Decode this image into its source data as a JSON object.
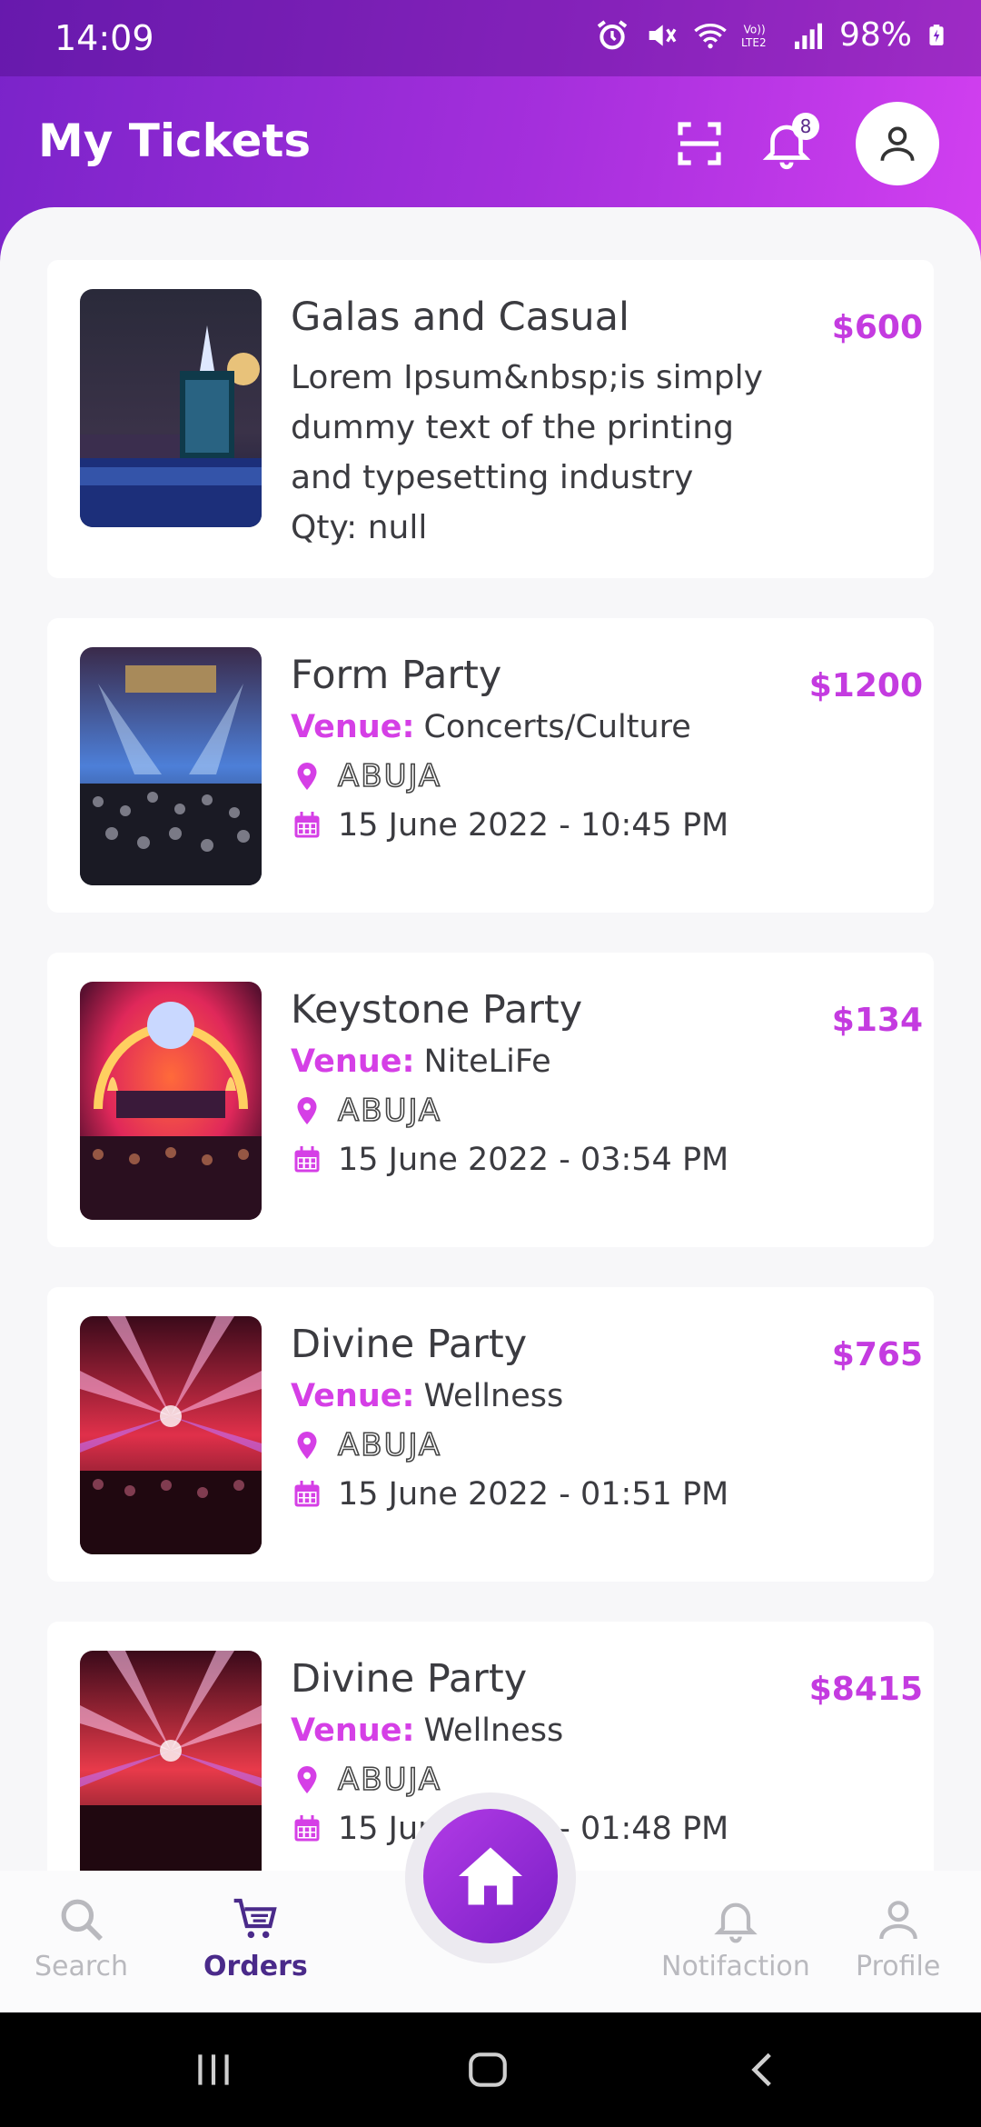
{
  "status": {
    "time": "14:09",
    "battery": "98%"
  },
  "header": {
    "title": "My Tickets",
    "notification_count": "8"
  },
  "tickets": [
    {
      "title": "Galas and Casual",
      "price": "$600",
      "description": "Lorem Ipsum&nbsp;is simply dummy text of the printing and typesetting industry",
      "qty": "Qty: null"
    },
    {
      "title": "Form Party",
      "price": "$1200",
      "venue_label": "Venue:",
      "venue": "Concerts/Culture",
      "city": "ABUJA",
      "datetime": "15 June 2022 - 10:45 PM"
    },
    {
      "title": "Keystone Party",
      "price": "$134",
      "venue_label": "Venue:",
      "venue": "NiteLiFe",
      "city": "ABUJA",
      "datetime": "15 June 2022 - 03:54 PM"
    },
    {
      "title": "Divine Party",
      "price": "$765",
      "venue_label": "Venue:",
      "venue": "Wellness",
      "city": "ABUJA",
      "datetime": "15 June 2022 - 01:51 PM"
    },
    {
      "title": "Divine Party",
      "price": "$8415",
      "venue_label": "Venue:",
      "venue": "Wellness",
      "city": "ABUJA",
      "datetime": "15 June 2022 - 01:48 PM"
    }
  ],
  "nav": {
    "search": "Search",
    "orders": "Orders",
    "notification": "Notifaction",
    "profile": "Profile"
  },
  "colors": {
    "accent": "#c43be0",
    "header_start": "#7a23c9",
    "header_end": "#d23ff0",
    "active_nav": "#4a2a8a"
  }
}
